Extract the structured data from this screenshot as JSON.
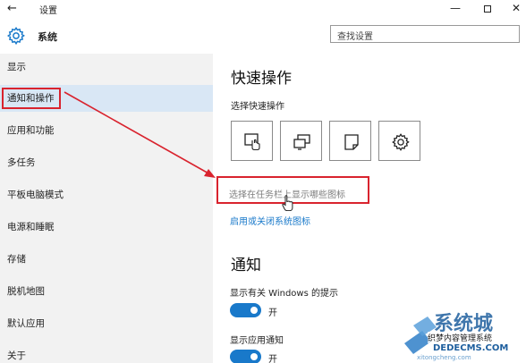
{
  "window": {
    "title": "设置",
    "back_glyph": "←",
    "minimize_glyph": "—",
    "close_glyph": "✕"
  },
  "header": {
    "title": "系统",
    "search_placeholder": "查找设置"
  },
  "nav": {
    "items": [
      {
        "label": "显示"
      },
      {
        "label": "通知和操作"
      },
      {
        "label": "应用和功能"
      },
      {
        "label": "多任务"
      },
      {
        "label": "平板电脑模式"
      },
      {
        "label": "电源和睡眠"
      },
      {
        "label": "存储"
      },
      {
        "label": "脱机地图"
      },
      {
        "label": "默认应用"
      },
      {
        "label": "关于"
      }
    ],
    "selected_index": 1
  },
  "quick_actions": {
    "heading": "快速操作",
    "subheading": "选择快速操作",
    "buttons": [
      {
        "icon": "tablet-mode-icon"
      },
      {
        "icon": "project-icon"
      },
      {
        "icon": "note-icon"
      },
      {
        "icon": "settings-gear-icon"
      }
    ],
    "taskbar_icons_link": "选择在任务栏上显示哪些图标",
    "system_icons_link": "启用或关闭系统图标"
  },
  "notifications": {
    "heading": "通知",
    "windows_tips_label": "显示有关 Windows 的提示",
    "windows_tips_state": "开",
    "app_notifications_label": "显示应用通知",
    "app_notifications_state": "开"
  },
  "watermark": {
    "line1": "系统城",
    "line2": "织梦内容管理系统",
    "line3": "DEDECMS.COM",
    "line4": "xitongcheng.com"
  },
  "colors": {
    "accent": "#1979ca",
    "highlight_red": "#d9232e",
    "nav_bg": "#f2f2f2",
    "nav_selected": "#d9e7f5"
  }
}
